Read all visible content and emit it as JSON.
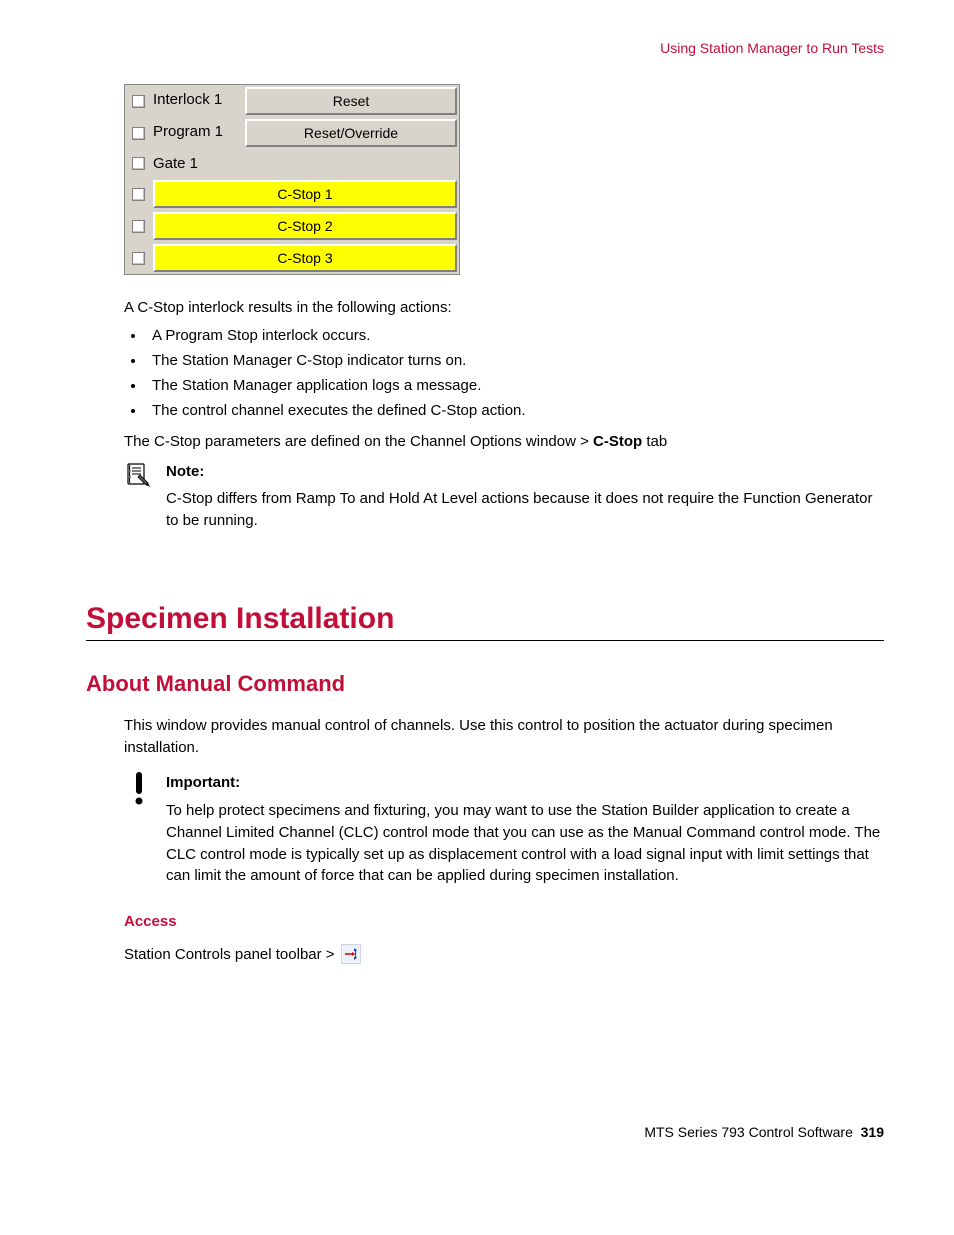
{
  "header": {
    "breadcrumb": "Using Station Manager to Run Tests"
  },
  "panel": {
    "rows": [
      {
        "checkbox": true,
        "label": "Interlock 1",
        "button": "Reset"
      },
      {
        "checkbox": true,
        "label": "Program 1",
        "button": "Reset/Override"
      },
      {
        "checkbox": true,
        "label": "Gate 1",
        "button": null
      }
    ],
    "cstops": [
      "C-Stop 1",
      "C-Stop 2",
      "C-Stop 3"
    ]
  },
  "intro_after_panel": "A C-Stop interlock results in the following actions:",
  "bullets": [
    "A Program Stop interlock occurs.",
    "The Station Manager C-Stop indicator turns on.",
    "The Station Manager application logs a message.",
    "The control channel executes the defined C-Stop action."
  ],
  "params_line_pre": "The C-Stop parameters are defined on the Channel Options window > ",
  "params_line_bold": "C-Stop",
  "params_line_post": " tab",
  "note": {
    "label": "Note:",
    "text": "C-Stop differs from Ramp To and Hold At Level actions because it does not require the Function Generator to be running."
  },
  "section": {
    "title": "Specimen Installation",
    "subsection": "About Manual Command",
    "intro": "This window provides manual control of channels. Use this control to position the actuator during specimen installation.",
    "important": {
      "label": "Important:",
      "text": "To help protect specimens and fixturing, you may want to use the Station Builder application to create a Channel Limited Channel (CLC) control mode that you can use as the Manual Command control mode. The CLC control mode is typically set up as displacement control with a load signal input with limit settings that can limit the amount of force that can be applied during specimen installation."
    },
    "access": {
      "heading": "Access",
      "line": "Station Controls panel toolbar > "
    }
  },
  "footer": {
    "product": "MTS Series 793 Control Software",
    "page": "319"
  }
}
